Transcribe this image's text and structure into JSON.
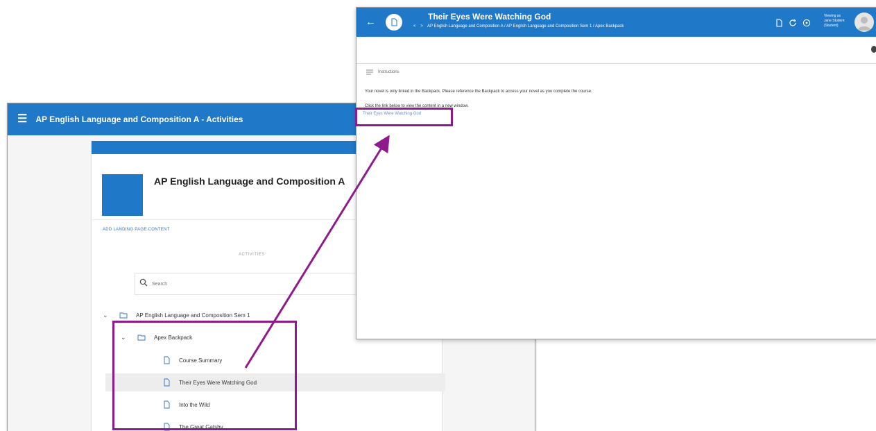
{
  "top_mark": "'",
  "colors": {
    "header_blue": "#1f78c8",
    "annotation_purple": "#8e1a8c",
    "link_blue": "#2a73c9"
  },
  "activities_window": {
    "header_title": "AP English Language and Composition A - Activities",
    "menu_icon": "hamburger-icon",
    "course_title": "AP English Language and Composition A",
    "add_landing_link": "ADD LANDING PAGE CONTENT",
    "activities_label": "ACTIVITIES",
    "search": {
      "placeholder": "Search",
      "value": ""
    },
    "tree": {
      "root": {
        "label": "AP English Language and Composition Sem 1",
        "icon": "folder-icon",
        "expanded": true
      },
      "folder": {
        "label": "Apex Backpack",
        "icon": "folder-icon",
        "expanded": true
      },
      "items": [
        {
          "label": "Course Summary",
          "icon": "document-icon"
        },
        {
          "label": "Their Eyes Were Watching God",
          "icon": "document-icon",
          "selected": true
        },
        {
          "label": "Into the Wild",
          "icon": "document-icon"
        },
        {
          "label": "The Great Gatsby",
          "icon": "document-icon"
        }
      ]
    }
  },
  "reader_window": {
    "title": "Their Eyes Were Watching God",
    "breadcrumb": "AP English Language and Composition A / AP English Language and Composition Sem 1 / Apex Backpack",
    "header_icons": [
      "document-icon",
      "refresh-icon",
      "help-icon"
    ],
    "user_lines": [
      "Viewing as",
      "Jane Student",
      "(Student)"
    ],
    "instructions_label": "Instructions",
    "paragraph_1": "Your novel is only linked in the Backpack. Please reference the Backpack to access your novel as you complete the course.",
    "paragraph_2": "Click the link below to view the content in a new window.",
    "link_text": "Their Eyes Were Watching God"
  }
}
